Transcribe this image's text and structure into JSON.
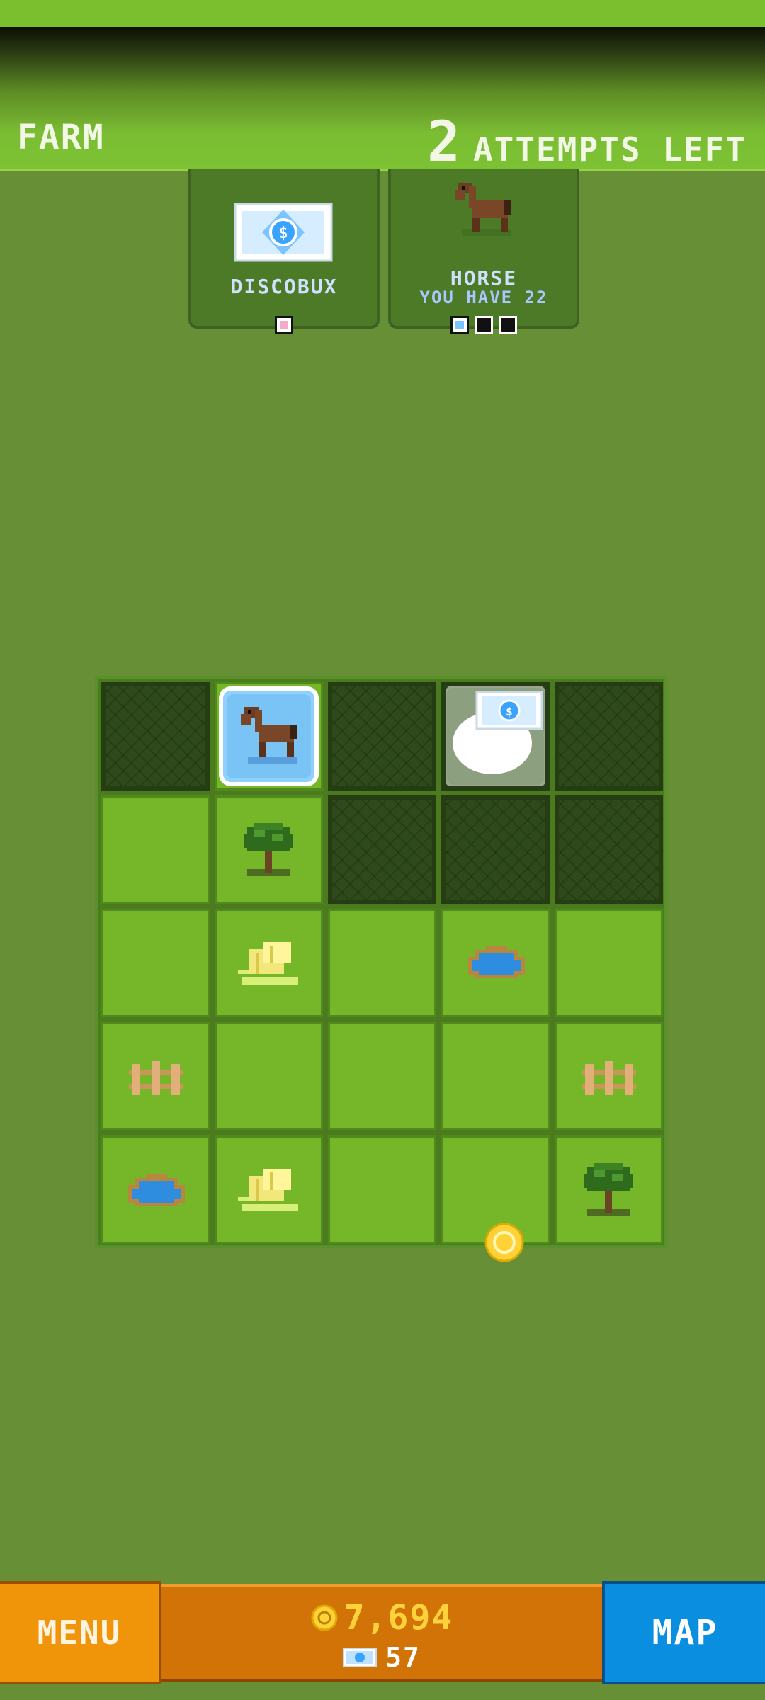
{
  "header": {
    "level_name": "FARM",
    "attempts_count": "2",
    "attempts_label": "ATTEMPTS LEFT"
  },
  "goals": [
    {
      "name": "DISCOBUX",
      "sub": "",
      "icon": "discobux-bill-icon",
      "progress": "0 of 1"
    },
    {
      "name": "HORSE",
      "sub": "YOU HAVE 22",
      "icon": "horse-icon",
      "progress": "0 of 3"
    }
  ],
  "board": {
    "rows": [
      [
        "locked",
        "horse (selected)",
        "locked",
        "discobux-cloud",
        "locked"
      ],
      [
        "grass",
        "tree",
        "locked",
        "locked",
        "locked"
      ],
      [
        "grass",
        "hay",
        "grass",
        "pond",
        "grass"
      ],
      [
        "fence",
        "grass",
        "grass",
        "grass",
        "fence"
      ],
      [
        "pond",
        "hay",
        "grass",
        "grass",
        "tree"
      ]
    ]
  },
  "currency": {
    "coins": "7,694",
    "discobux": "57"
  },
  "buttons": {
    "menu": "MENU",
    "map": "MAP"
  },
  "colors": {
    "background": "#678f35",
    "grass": "#76b72a",
    "locked": "#2f4a1a",
    "menu": "#f0950a",
    "currency_panel": "#d27308",
    "map": "#0a8fe0",
    "coin": "#ffd23a"
  }
}
